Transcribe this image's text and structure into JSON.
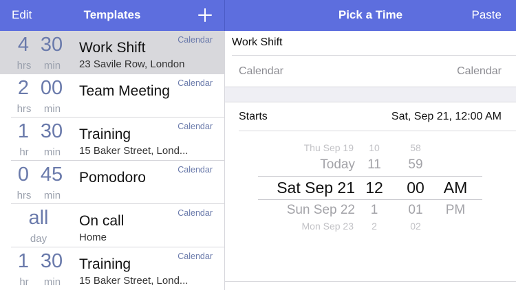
{
  "navbar": {
    "edit_label": "Edit",
    "templates_title": "Templates",
    "add_icon": "plus-icon",
    "pick_title": "Pick a Time",
    "paste_label": "Paste"
  },
  "colors": {
    "accent": "#5d6ede",
    "number_text": "#6a7aab",
    "selected_row": "#d8d8dc",
    "group_background": "#efeff4"
  },
  "templates": [
    {
      "num1": "4",
      "unit1": "hrs",
      "num2": "30",
      "unit2": "min",
      "title": "Work Shift",
      "subtitle": "23 Savile Row, London",
      "calendar": "Calendar",
      "selected": true
    },
    {
      "num1": "2",
      "unit1": "hrs",
      "num2": "00",
      "unit2": "min",
      "title": "Team Meeting",
      "subtitle": "",
      "calendar": "Calendar"
    },
    {
      "num1": "1",
      "unit1": "hr",
      "num2": "30",
      "unit2": "min",
      "title": "Training",
      "subtitle": "15 Baker Street, Lond...",
      "calendar": "Calendar"
    },
    {
      "num1": "0",
      "unit1": "hrs",
      "num2": "45",
      "unit2": "min",
      "title": "Pomodoro",
      "subtitle": "",
      "calendar": "Calendar"
    },
    {
      "num1": "all",
      "unit1": "day",
      "num2": "",
      "unit2": "",
      "title": "On call",
      "subtitle": "Home",
      "calendar": "Calendar"
    },
    {
      "num1": "1",
      "unit1": "hr",
      "num2": "30",
      "unit2": "min",
      "title": "Training",
      "subtitle": "15 Baker Street, Lond...",
      "calendar": "Calendar"
    }
  ],
  "detail": {
    "name": "Work Shift",
    "calendar_label": "Calendar",
    "calendar_value": "Calendar",
    "starts_label": "Starts",
    "starts_value": "Sat, Sep 21, 12:00 AM"
  },
  "picker": {
    "dates": [
      "Thu Sep 19",
      "Today",
      "Sat Sep 21",
      "Sun Sep 22",
      "Mon Sep 23"
    ],
    "hours": [
      "10",
      "11",
      "12",
      "1",
      "2"
    ],
    "minutes": [
      "58",
      "59",
      "00",
      "01",
      "02"
    ],
    "ampm": [
      "",
      "",
      "AM",
      "PM",
      ""
    ]
  }
}
